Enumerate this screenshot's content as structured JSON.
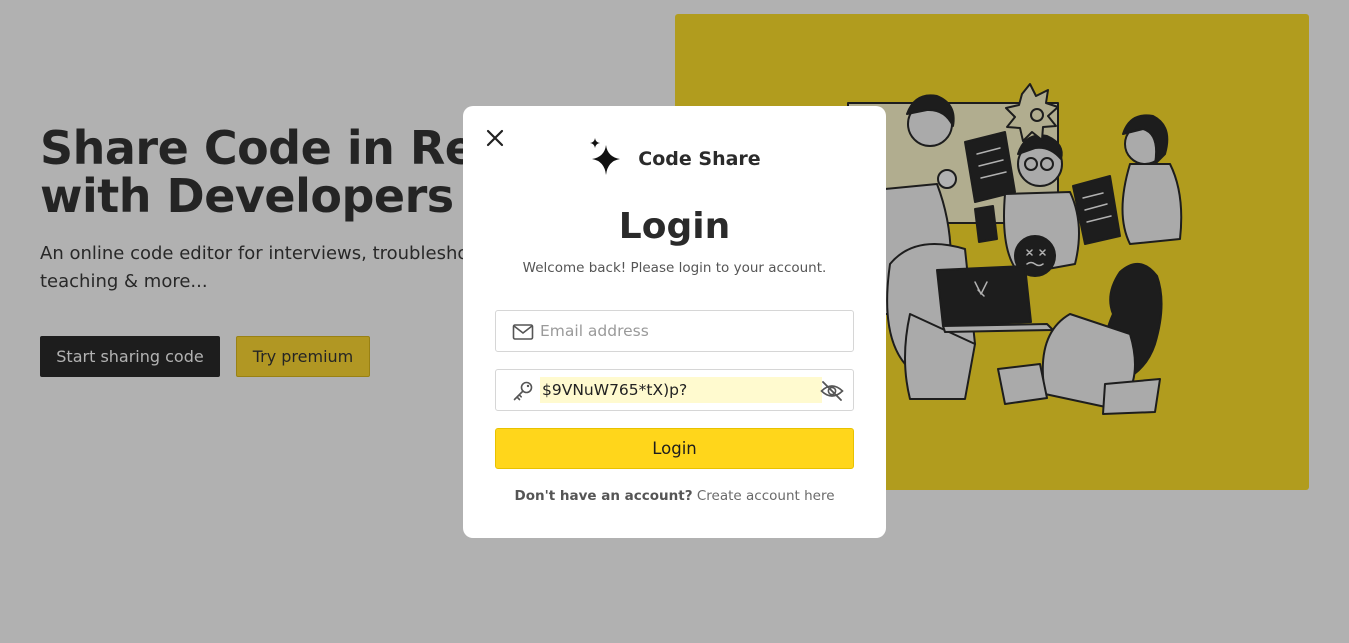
{
  "hero": {
    "title": "Share Code in Real-time\nwith Developers",
    "subtitle": "An online code editor for interviews, troubleshooting, teaching & more...",
    "start_button": "Start sharing code",
    "premium_button": "Try premium"
  },
  "colors": {
    "accent": "#ffd61b",
    "illustration_bg": "#ffdd12",
    "dark_button": "#111111"
  },
  "modal": {
    "brand_name": "Code Share",
    "title": "Login",
    "subtitle": "Welcome back! Please login to your account.",
    "email": {
      "placeholder": "Email address",
      "value": ""
    },
    "password": {
      "value": "$9VNuW765*tX)p?"
    },
    "login_button": "Login",
    "footer_question": "Don't have an account?",
    "footer_link": "Create account here"
  },
  "icons": {
    "close": "close-icon",
    "logo": "sparkle-icon",
    "email": "mail-icon",
    "password": "key-icon",
    "visibility": "eye-off-icon"
  }
}
